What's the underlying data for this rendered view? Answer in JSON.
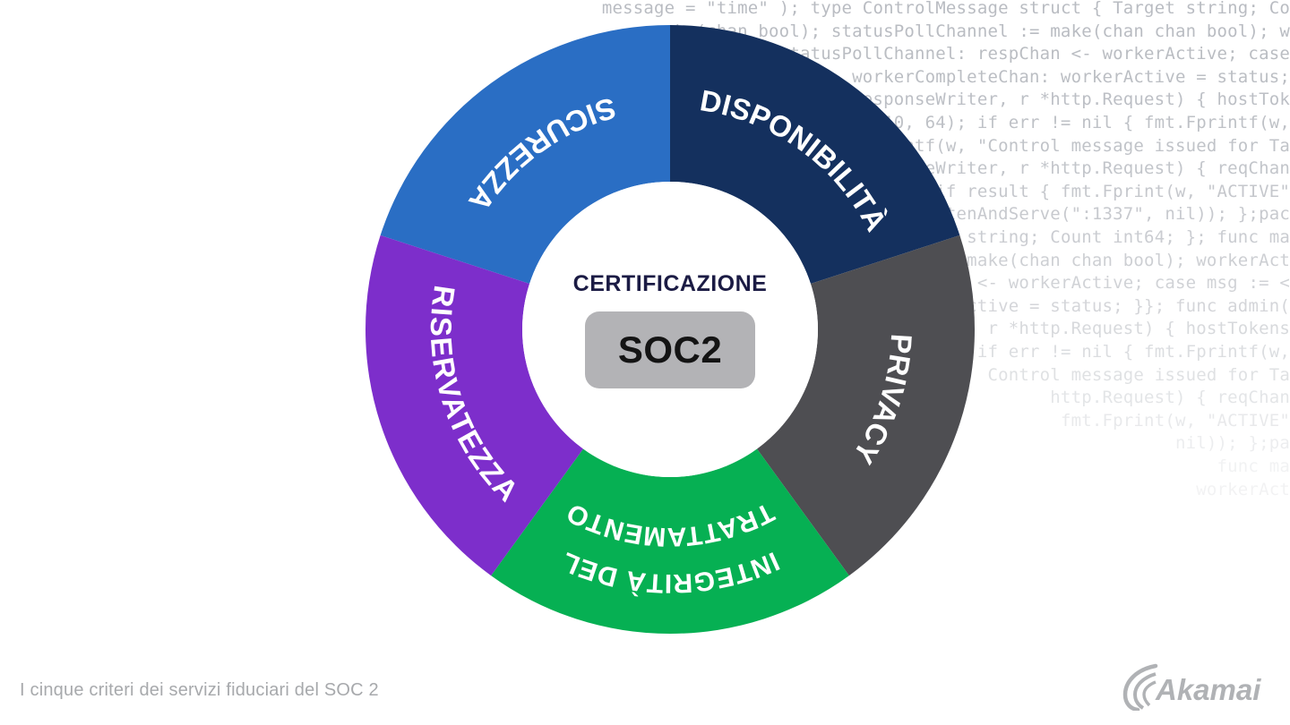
{
  "caption": "I cinque criteri dei servizi fiduciari del SOC 2",
  "logo": {
    "name": "akamai-logo",
    "alt": "Akamai"
  },
  "center": {
    "title": "CERTIFICAZIONE",
    "badge": "SOC2",
    "badge_bg": "#b3b3b6",
    "title_color": "#1b1b44"
  },
  "colors": {
    "blue": "#2a6ec4",
    "navy": "#14305e",
    "grey": "#4e4e52",
    "green": "#06b053",
    "purple": "#7d2ecb",
    "background": "#ffffff",
    "code_text": "#b9bcc2",
    "caption_text": "#a7a9ac"
  },
  "chart_data": {
    "type": "pie",
    "title": "I cinque criteri dei servizi fiduciari del SOC 2",
    "subtitle": "CERTIFICAZIONE SOC2",
    "legend": "none",
    "donut": true,
    "inner_radius_ratio": 0.485,
    "categories": [
      "SICUREZZA",
      "DISPONIBILITÀ",
      "PRIVACY",
      "INTEGRITÀ DEL TRATTAMENTO",
      "RISERVATEZZA"
    ],
    "values": [
      72,
      72,
      72,
      72,
      72
    ],
    "units": "degrees",
    "segments": [
      {
        "label": "SICUREZZA",
        "lines": [
          "SICUREZZA"
        ],
        "color": "#2a6ec4",
        "start_angle": 288,
        "end_angle": 360,
        "label_angle": 324
      },
      {
        "label": "DISPONIBILITÀ",
        "lines": [
          "DISPONIBILITÀ"
        ],
        "color": "#14305e",
        "start_angle": 0,
        "end_angle": 72,
        "label_angle": 36
      },
      {
        "label": "PRIVACY",
        "lines": [
          "PRIVACY"
        ],
        "color": "#4e4e52",
        "start_angle": 72,
        "end_angle": 144,
        "label_angle": 108
      },
      {
        "label": "INTEGRITÀ DEL TRATTAMENTO",
        "lines": [
          "INTEGRITÀ DEL",
          "TRATTAMENTO"
        ],
        "color": "#06b053",
        "start_angle": 144,
        "end_angle": 216,
        "label_angle": 180
      },
      {
        "label": "RISERVATEZZA",
        "lines": [
          "RISERVATEZZA"
        ],
        "color": "#7d2ecb",
        "start_angle": 216,
        "end_angle": 288,
        "label_angle": 252
      }
    ]
  },
  "background_code": [
    "message = \"time\" ); type ControlMessage struct { Target string; Co",
    "make(chan bool); statusPollChannel := make(chan chan bool); w",
    "case statusPollChannel: respChan <- workerActive; case",
    "status := <- workerCompleteChan: workerActive = status;",
    "func admin(w http.ResponseWriter, r *http.Request) { hostTok",
    "ParseInt(r.FormValue(\"count\"), 10, 64); if err != nil { fmt.Fprintf(w,",
    "fmt.Fprintf(w, \"Control message issued for Ta",
    "func healthz(w http.ResponseWriter, r *http.Request) { reqChan",
    "result := <-respChan; if result { fmt.Fprint(w, \"ACTIVE\"",
    "log.Fatal(http.ListenAndServe(\":1337\", nil)); };pac",
    "Target string; Count int64; }; func ma",
    "workerCompleteChan := make(chan chan bool); workerAct",
    "respChan <- workerActive; case msg := <",
    "workerActive = status; }}; func admin(",
    "r *http.Request) { hostTokens",
    "if err != nil { fmt.Fprintf(w,",
    "Control message issued for Ta",
    "http.Request) { reqChan",
    "fmt.Fprint(w, \"ACTIVE\"",
    "nil)); };pa",
    "func ma",
    "workerAct"
  ]
}
